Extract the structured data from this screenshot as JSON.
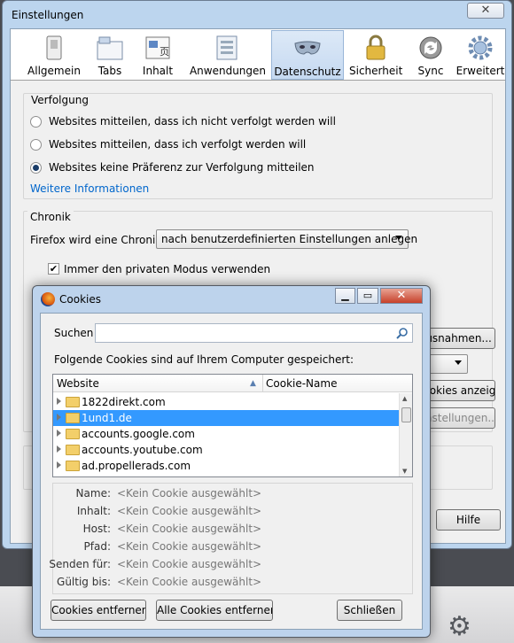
{
  "window": {
    "title": "Einstellungen",
    "close": "✕"
  },
  "toolbar": {
    "tabs": [
      {
        "label": "Allgemein",
        "icon": "switch-icon"
      },
      {
        "label": "Tabs",
        "icon": "tabs-icon"
      },
      {
        "label": "Inhalt",
        "icon": "content-icon"
      },
      {
        "label": "Anwendungen",
        "icon": "applications-icon"
      },
      {
        "label": "Datenschutz",
        "icon": "mask-icon"
      },
      {
        "label": "Sicherheit",
        "icon": "padlock-icon"
      },
      {
        "label": "Sync",
        "icon": "sync-icon"
      },
      {
        "label": "Erweitert",
        "icon": "gear-icon"
      }
    ],
    "selected": "Datenschutz"
  },
  "tracking": {
    "legend": "Verfolgung",
    "options": [
      "Websites mitteilen, dass ich nicht verfolgt werden will",
      "Websites mitteilen, dass ich verfolgt werden will",
      "Websites keine Präferenz zur Verfolgung mitteilen"
    ],
    "selected_index": 2,
    "more_link": "Weitere Informationen"
  },
  "history": {
    "legend": "Chronik",
    "label": "Firefox wird eine Chronik:",
    "combo_value": "nach benutzerdefinierten Einstellungen anlegen",
    "private_mode": "Immer den privaten Modus verwenden",
    "private_mode_checked": "✔",
    "exceptions_button": "Ausnahmen...",
    "show_cookies_button": "Cookies anzeigen...",
    "settings_button": "Einstellungen...",
    "partial_combo": ""
  },
  "help_button": "Hilfe",
  "cookies_dialog": {
    "title": "Cookies",
    "search_label": "Suchen",
    "search_value": "",
    "info": "Folgende Cookies sind auf Ihrem Computer gespeichert:",
    "columns": [
      "Website",
      "Cookie-Name"
    ],
    "rows": [
      "1822direkt.com",
      "1und1.de",
      "accounts.google.com",
      "accounts.youtube.com",
      "ad.propellerads.com"
    ],
    "selected_row": 1,
    "details": [
      {
        "key": "Name:",
        "value": "<Kein Cookie ausgewählt>"
      },
      {
        "key": "Inhalt:",
        "value": "<Kein Cookie ausgewählt>"
      },
      {
        "key": "Host:",
        "value": "<Kein Cookie ausgewählt>"
      },
      {
        "key": "Pfad:",
        "value": "<Kein Cookie ausgewählt>"
      },
      {
        "key": "Senden für:",
        "value": "<Kein Cookie ausgewählt>"
      },
      {
        "key": "Gültig bis:",
        "value": "<Kein Cookie ausgewählt>"
      }
    ],
    "remove_button": "Cookies entfernen",
    "remove_all_button": "Alle Cookies entfernen",
    "close_button": "Schließen"
  },
  "colors": {
    "selection": "#3399ff",
    "link": "#0066cc",
    "selected_tab": "#c5d9f1"
  }
}
